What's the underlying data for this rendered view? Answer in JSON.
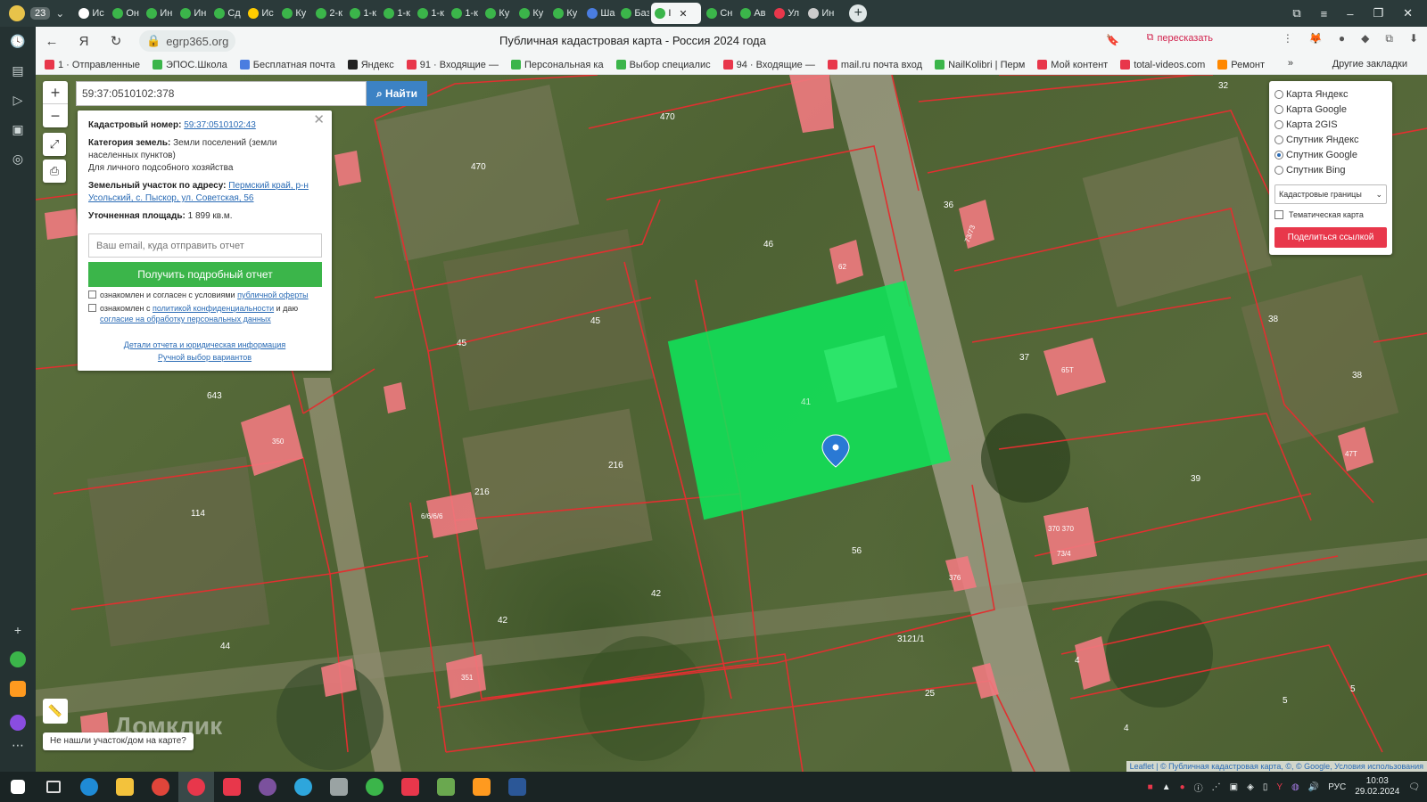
{
  "tabs": {
    "counter": "23",
    "items": [
      {
        "label": "Ис",
        "color": "#ffffff"
      },
      {
        "label": "Он",
        "color": "#3bb54a"
      },
      {
        "label": "Ин",
        "color": "#3bb54a"
      },
      {
        "label": "Ин",
        "color": "#3bb54a"
      },
      {
        "label": "Сд",
        "color": "#3bb54a"
      },
      {
        "label": "Ис",
        "color": "#ffcc00"
      },
      {
        "label": "Ку",
        "color": "#3bb54a"
      },
      {
        "label": "2-к",
        "color": "#3bb54a"
      },
      {
        "label": "1-к",
        "color": "#3bb54a"
      },
      {
        "label": "1-к",
        "color": "#3bb54a"
      },
      {
        "label": "1-к",
        "color": "#3bb54a"
      },
      {
        "label": "1-к",
        "color": "#3bb54a"
      },
      {
        "label": "Ку",
        "color": "#3bb54a"
      },
      {
        "label": "Ку",
        "color": "#3bb54a"
      },
      {
        "label": "Ку",
        "color": "#3bb54a"
      },
      {
        "label": "Ша",
        "color": "#4a7de0"
      },
      {
        "label": "Баз",
        "color": "#3bb54a"
      },
      {
        "label": "I",
        "color": "#3bb54a",
        "active": true
      },
      {
        "label": "Сн",
        "color": "#3bb54a"
      },
      {
        "label": "Ав",
        "color": "#3bb54a"
      },
      {
        "label": "Ул",
        "color": "#e8374b"
      },
      {
        "label": "Ин",
        "color": "#cccccc"
      }
    ]
  },
  "address_bar": {
    "url": "egrp365.org",
    "page_title": "Публичная кадастровая карта - Россия 2024 года",
    "retell_label": "пересказать"
  },
  "bookmarks": [
    {
      "label": "1 · Отправленные",
      "color": "#e8374b"
    },
    {
      "label": "ЭПОС.Школа",
      "color": "#3bb54a"
    },
    {
      "label": "Бесплатная почта",
      "color": "#4a7de0"
    },
    {
      "label": "Яндекс",
      "color": "#222222"
    },
    {
      "label": "91 · Входящие —",
      "color": "#e8374b"
    },
    {
      "label": "Персональная ка",
      "color": "#3bb54a"
    },
    {
      "label": "Выбор специалис",
      "color": "#3bb54a"
    },
    {
      "label": "94 · Входящие —",
      "color": "#e8374b"
    },
    {
      "label": "mail.ru почта вход",
      "color": "#e8374b"
    },
    {
      "label": "NailKolibri | Перм",
      "color": "#3bb54a"
    },
    {
      "label": "Мой контент",
      "color": "#e8374b"
    },
    {
      "label": "total-videos.com",
      "color": "#e8374b"
    },
    {
      "label": "Ремонт",
      "color": "#ff8800"
    }
  ],
  "other_bookmarks": "Другие закладки",
  "search": {
    "value": "59:37:0510102:378",
    "button": "Найти"
  },
  "info": {
    "cad_label": "Кадастровый номер:",
    "cad_value": "59:37:0510102:43",
    "cat_label": "Категория земель:",
    "cat_value": "Земли поселений (земли населенных пунктов)",
    "use_value": "Для личного подсобного хозяйства",
    "addr_label": "Земельный участок по адресу:",
    "addr_value": "Пермский край, р-н Усольский, с. Пыскор, ул. Советская, 56",
    "area_label": "Уточненная площадь:",
    "area_value": "1 899 кв.м.",
    "email_placeholder": "Ваш email, куда отправить отчет",
    "report_button": "Получить подробный отчет",
    "agree1_text": "ознакомлен и согласен с условиями",
    "agree1_link": "публичной оферты",
    "agree2_text": "ознакомлен с",
    "agree2_link": "политикой конфиденциальности",
    "agree2_mid": "и даю",
    "agree2_link2": "согласие на обработку персональных данных",
    "details_link": "Детали отчета и юридическая информация",
    "manual_link": "Ручной выбор вариантов"
  },
  "layers": {
    "options": [
      "Карта Яндекс",
      "Карта Google",
      "Карта 2GIS",
      "Спутник Яндекс",
      "Спутник Google",
      "Спутник Bing"
    ],
    "selected_index": 4,
    "select_value": "Кадастровые границы",
    "thematic": "Тематическая карта",
    "share": "Поделиться ссылкой"
  },
  "map": {
    "help": "Не нашли участок/дом на карте?",
    "watermark": "Домклик",
    "attribution": "Leaflet | © Публичная кадастровая карта, ©, © Google, Условия использования",
    "parcel_labels": [
      "470",
      "470",
      "46",
      "45",
      "45",
      "643",
      "216",
      "216",
      "114",
      "42",
      "42",
      "44",
      "56",
      "3121/1",
      "25",
      "37",
      "38",
      "38",
      "39",
      "36",
      "32",
      "4",
      "5",
      "5",
      "4",
      "41"
    ],
    "house_labels": [
      "6/6/6/6",
      "65Т",
      "350",
      "73/73",
      "370 370",
      "73/4",
      "376",
      "351",
      "47Т",
      "62"
    ]
  },
  "taskbar": {
    "lang": "РУС",
    "time": "10:03",
    "date": "29.02.2024"
  }
}
